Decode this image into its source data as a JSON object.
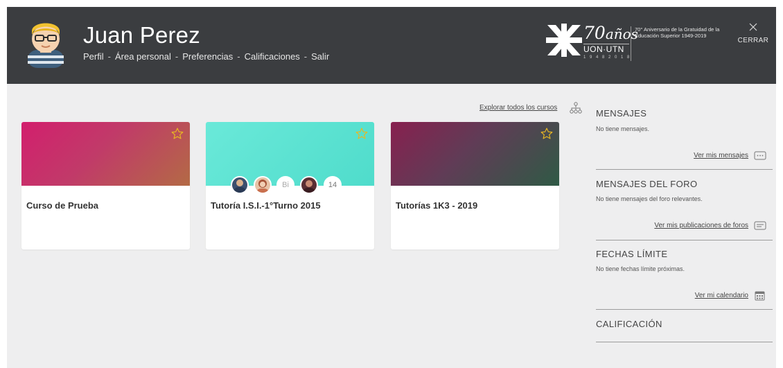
{
  "header": {
    "user_name": "Juan Perez",
    "nav": [
      "Perfil",
      "Área personal",
      "Preferencias",
      "Calificaciones",
      "Salir"
    ],
    "nav_separator": "-",
    "logo": {
      "anniv_number": "70",
      "anniv_word": "años",
      "org": "UON·UTN",
      "years": "1 9 4 8   2 0 1 8",
      "text": "70° Aniversario de la Gratuidad de la Educación Superior 1949-2019"
    },
    "close_label": "CERRAR"
  },
  "courses": {
    "explore_label": "Explorar todos los cursos",
    "items": [
      {
        "title": "Curso de Prueba"
      },
      {
        "title": "Tutoría I.S.I.-1°Turno 2015",
        "participant_partial": "Bi",
        "participant_count": "14"
      },
      {
        "title": "Tutorías 1K3 - 2019"
      }
    ]
  },
  "sidebar": {
    "messages": {
      "title": "MENSAJES",
      "text": "No tiene mensajes.",
      "link": "Ver mis mensajes"
    },
    "forum": {
      "title": "MENSAJES DEL FORO",
      "text": "No tiene mensajes del foro relevantes.",
      "link": "Ver mis publicaciones de foros"
    },
    "deadlines": {
      "title": "FECHAS LÍMITE",
      "text": "No tiene fechas límite próximas.",
      "link": "Ver mi calendario"
    },
    "grades": {
      "title": "CALIFICACIÓN"
    }
  },
  "colors": {
    "header_bg": "#3b3d40",
    "page_bg": "#eeeeef",
    "star": "#e9b722"
  }
}
